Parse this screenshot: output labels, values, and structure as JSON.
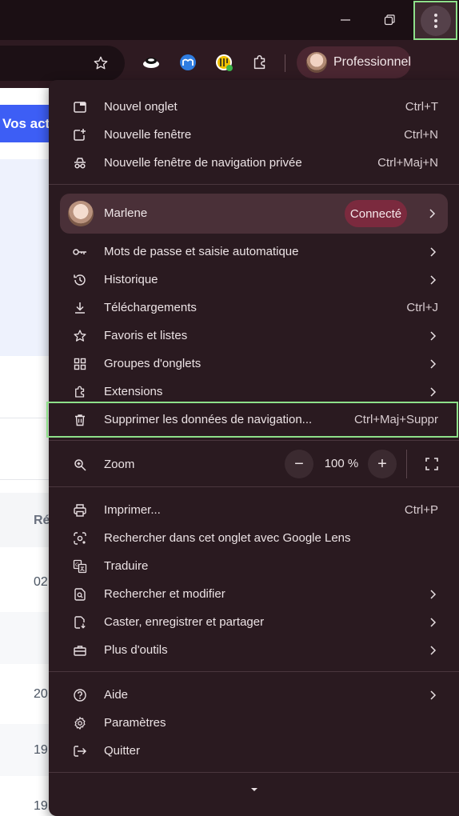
{
  "toolbar": {
    "profile_chip_label": "Professionnel"
  },
  "page_behind": {
    "button_text": "Vos act",
    "column_header": "Ré",
    "cells": [
      "02",
      "20",
      "19",
      "19"
    ]
  },
  "menu": {
    "group1": [
      {
        "label": "Nouvel onglet",
        "shortcut": "Ctrl+T",
        "icon": "new-tab-icon"
      },
      {
        "label": "Nouvelle fenêtre",
        "shortcut": "Ctrl+N",
        "icon": "new-window-icon"
      },
      {
        "label": "Nouvelle fenêtre de navigation privée",
        "shortcut": "Ctrl+Maj+N",
        "icon": "incognito-icon"
      }
    ],
    "profile": {
      "name": "Marlene",
      "badge": "Connecté"
    },
    "group2": [
      {
        "label": "Mots de passe et saisie automatique",
        "icon": "key-icon"
      },
      {
        "label": "Historique",
        "icon": "history-icon"
      },
      {
        "label": "Téléchargements",
        "shortcut": "Ctrl+J",
        "icon": "download-icon"
      },
      {
        "label": "Favoris et listes",
        "icon": "star-icon"
      },
      {
        "label": "Groupes d'onglets",
        "icon": "tab-groups-icon"
      },
      {
        "label": "Extensions",
        "icon": "extensions-icon"
      },
      {
        "label": "Supprimer les données de navigation...",
        "shortcut": "Ctrl+Maj+Suppr",
        "icon": "trash-icon"
      }
    ],
    "zoom": {
      "label": "Zoom",
      "value": "100 %",
      "minus": "−",
      "plus": "+"
    },
    "group3": [
      {
        "label": "Imprimer...",
        "shortcut": "Ctrl+P",
        "icon": "print-icon"
      },
      {
        "label": "Rechercher dans cet onglet avec Google Lens",
        "icon": "lens-icon"
      },
      {
        "label": "Traduire",
        "icon": "translate-icon"
      },
      {
        "label": "Rechercher et modifier",
        "icon": "find-edit-icon"
      },
      {
        "label": "Caster, enregistrer et partager",
        "icon": "cast-save-share-icon"
      },
      {
        "label": "Plus d'outils",
        "icon": "toolbox-icon"
      }
    ],
    "group4": [
      {
        "label": "Aide",
        "icon": "help-icon"
      },
      {
        "label": "Paramètres",
        "icon": "settings-icon"
      },
      {
        "label": "Quitter",
        "icon": "exit-icon"
      }
    ]
  },
  "colors": {
    "menu_bg": "#2a1a20",
    "toolbar_bg": "#2e1a21",
    "highlight_border": "#8ee08a",
    "badge_bg": "#7b2a3e",
    "page_button": "#3d5ef5"
  }
}
